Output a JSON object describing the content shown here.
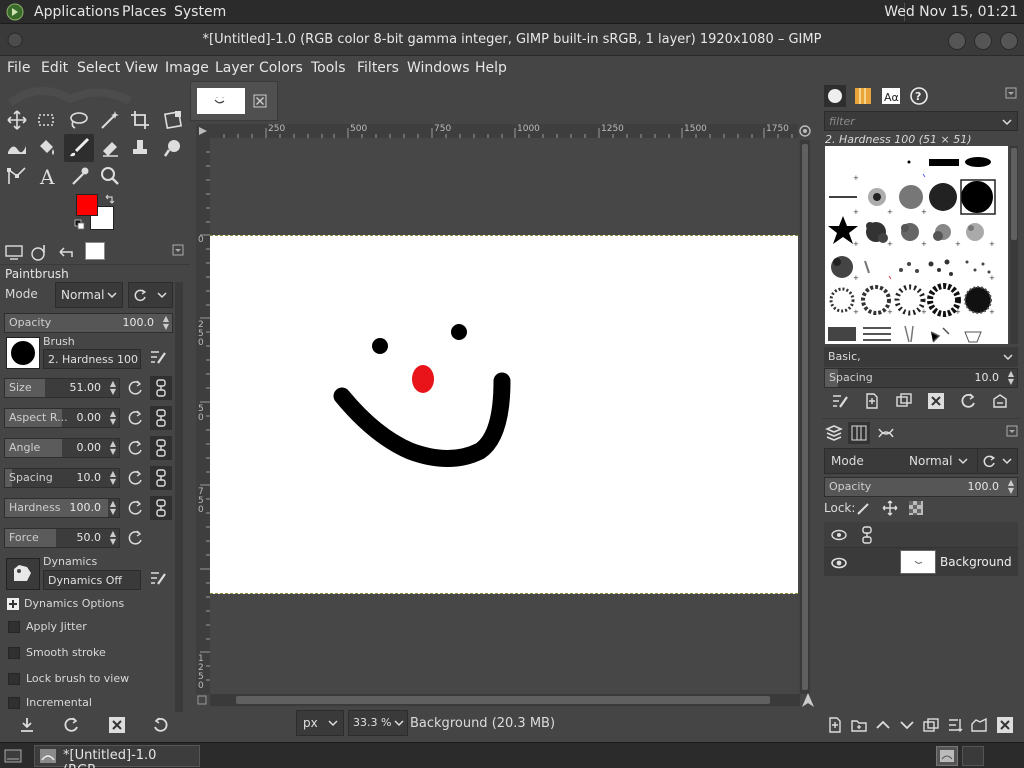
{
  "top_panel": {
    "applications": "Applications",
    "places": "Places",
    "system": "System",
    "clock": "Wed Nov 15, 01:21"
  },
  "window": {
    "title": "*[Untitled]-1.0 (RGB color 8-bit gamma integer, GIMP built-in sRGB, 1 layer) 1920x1080 – GIMP"
  },
  "menubar": [
    "File",
    "Edit",
    "Select",
    "View",
    "Image",
    "Layer",
    "Colors",
    "Tools",
    "Filters",
    "Windows",
    "Help"
  ],
  "colors": {
    "foreground": "#ff0000",
    "background": "#ffffff",
    "nose": "#e8141a"
  },
  "tool_options": {
    "title": "Paintbrush",
    "mode_label": "Mode",
    "mode_value": "Normal",
    "opacity_label": "Opacity",
    "opacity_value": "100.0",
    "brush_label": "Brush",
    "brush_value": "2. Hardness 100",
    "size_label": "Size",
    "size_value": "51.00",
    "aspect_label": "Aspect R...",
    "aspect_value": "0.00",
    "angle_label": "Angle",
    "angle_value": "0.00",
    "spacing_label": "Spacing",
    "spacing_value": "10.0",
    "hardness_label": "Hardness",
    "hardness_value": "100.0",
    "force_label": "Force",
    "force_value": "50.0",
    "dynamics_label": "Dynamics",
    "dynamics_value": "Dynamics Off",
    "dynamics_options": "Dynamics Options",
    "apply_jitter": "Apply Jitter",
    "smooth_stroke": "Smooth stroke",
    "lock_brush": "Lock brush to view",
    "incremental": "Incremental"
  },
  "ruler": {
    "top_ticks": [
      "250",
      "500",
      "750",
      "1000",
      "1250",
      "1500",
      "1750"
    ],
    "left_ticks": [
      "0",
      "2",
      "5",
      "0",
      "5",
      "0",
      "7",
      "5",
      "0",
      "1",
      "2",
      "5",
      "0"
    ]
  },
  "statusbar": {
    "unit": "px",
    "zoom": "33.3 %",
    "info": "Background (20.3 MB)"
  },
  "brushes": {
    "filter_placeholder": "filter",
    "selected": "2. Hardness 100 (51 × 51)",
    "preset": "Basic,",
    "spacing_label": "Spacing",
    "spacing_value": "10.0"
  },
  "layers": {
    "mode_label": "Mode",
    "mode_value": "Normal",
    "opacity_label": "Opacity",
    "opacity_value": "100.0",
    "lock_label": "Lock:",
    "layer_name": "Background"
  },
  "taskbar": {
    "item": "*[Untitled]-1.0 (RGB..."
  }
}
